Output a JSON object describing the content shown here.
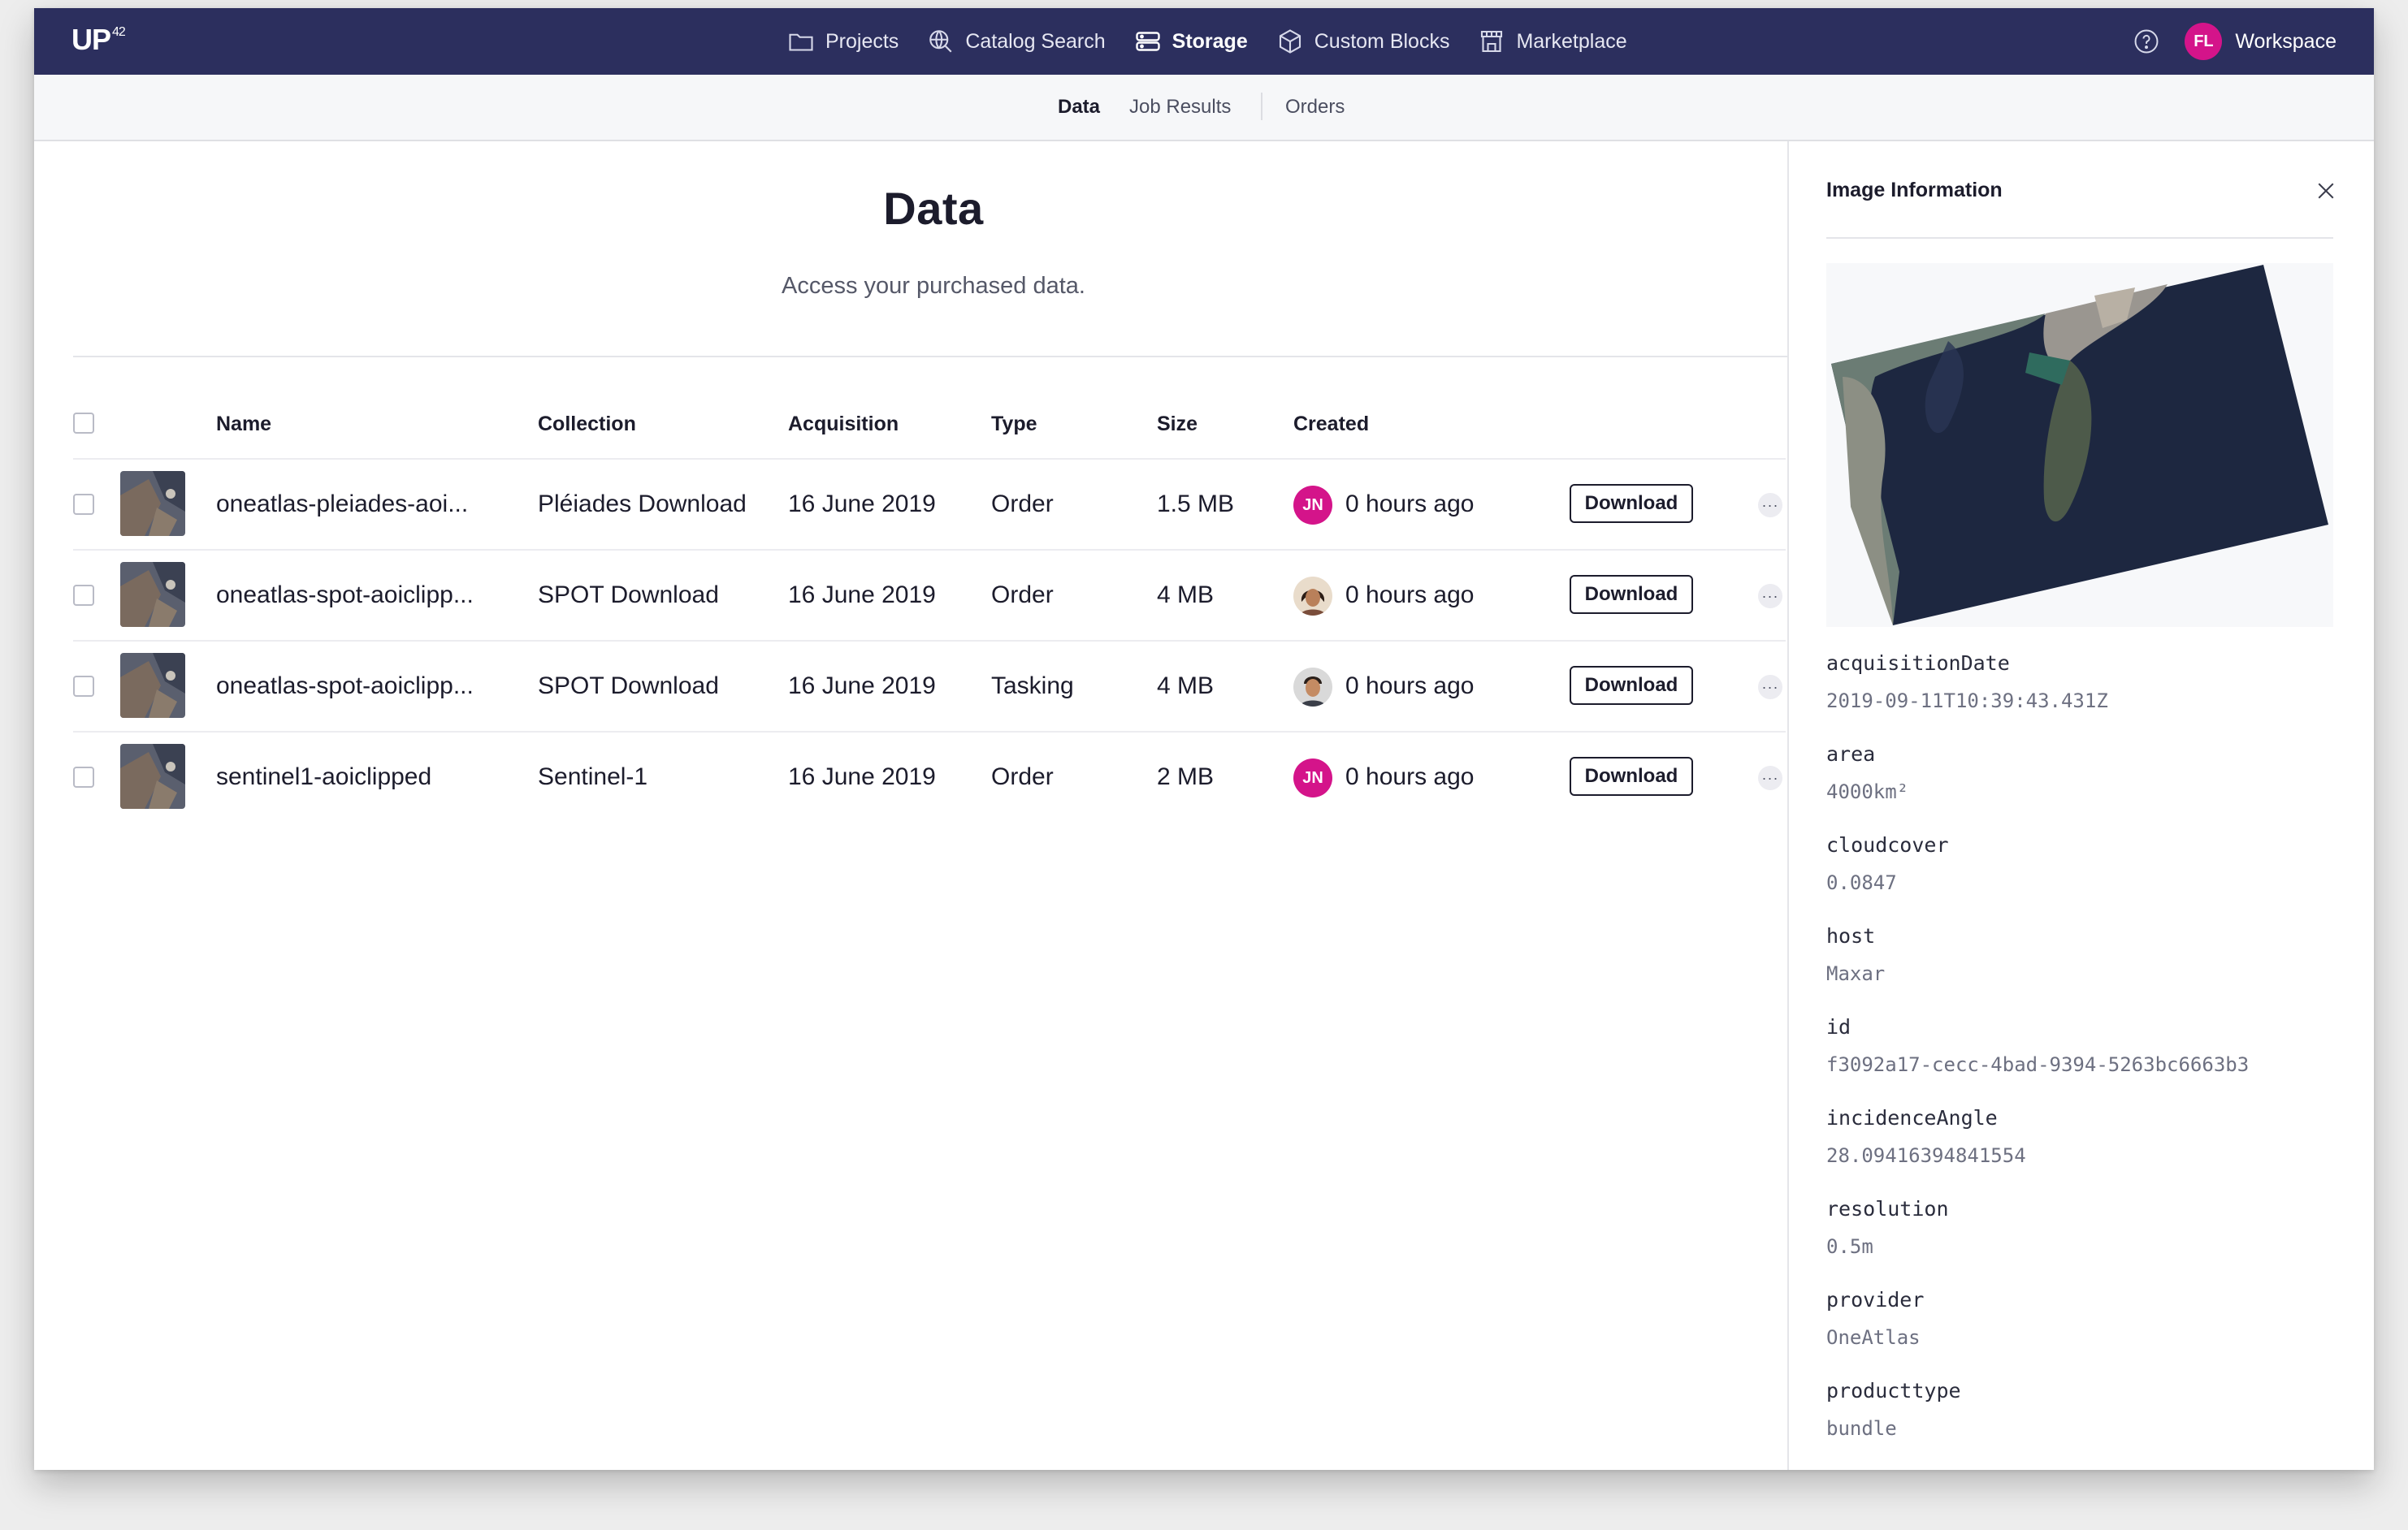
{
  "nav": {
    "logo": "UP",
    "logo_sup": "42",
    "items": [
      {
        "label": "Projects",
        "icon": "folder-icon"
      },
      {
        "label": "Catalog Search",
        "icon": "globe-search-icon"
      },
      {
        "label": "Storage",
        "icon": "storage-icon",
        "active": true
      },
      {
        "label": "Custom Blocks",
        "icon": "cube-icon"
      },
      {
        "label": "Marketplace",
        "icon": "store-icon"
      }
    ],
    "avatar_initials": "FL",
    "workspace": "Workspace"
  },
  "subnav": {
    "tabs": [
      "Data",
      "Job Results",
      "Orders"
    ],
    "active": "Data"
  },
  "main": {
    "title": "Data",
    "subtitle": "Access your purchased data.",
    "columns": {
      "name": "Name",
      "collection": "Collection",
      "acquisition": "Acquisition",
      "type": "Type",
      "size": "Size",
      "created": "Created"
    },
    "rows": [
      {
        "name": "oneatlas-pleiades-aoi...",
        "collection": "Pléiades Download",
        "acquisition": "16 June 2019",
        "type": "Order",
        "size": "1.5 MB",
        "avatar": "JN",
        "created": "0 hours ago",
        "action": "Download"
      },
      {
        "name": "oneatlas-spot-aoiclipp...",
        "collection": "SPOT Download",
        "acquisition": "16 June 2019",
        "type": "Order",
        "size": "4 MB",
        "avatar": "photo-woman",
        "created": "0 hours ago",
        "action": "Download"
      },
      {
        "name": "oneatlas-spot-aoiclipp...",
        "collection": "SPOT Download",
        "acquisition": "16 June 2019",
        "type": "Tasking",
        "size": "4 MB",
        "avatar": "photo-man",
        "created": "0 hours ago",
        "action": "Download"
      },
      {
        "name": "sentinel1-aoiclipped",
        "collection": "Sentinel-1",
        "acquisition": "16 June 2019",
        "type": "Order",
        "size": "2 MB",
        "avatar": "JN",
        "created": "0 hours ago",
        "action": "Download"
      }
    ]
  },
  "panel": {
    "title": "Image Information",
    "properties": [
      {
        "key": "acquisitionDate",
        "value": "2019-09-11T10:39:43.431Z"
      },
      {
        "key": "area",
        "value": "4000km²"
      },
      {
        "key": "cloudcover",
        "value": "0.0847"
      },
      {
        "key": "host",
        "value": "Maxar"
      },
      {
        "key": "id",
        "value": "f3092a17-cecc-4bad-9394-5263bc6663b3"
      },
      {
        "key": "incidenceAngle",
        "value": "28.09416394841554"
      },
      {
        "key": "resolution",
        "value": "0.5m"
      },
      {
        "key": "provider",
        "value": "OneAtlas"
      },
      {
        "key": "producttype",
        "value": "bundle"
      }
    ]
  },
  "colors": {
    "navbar": "#2c2f5e",
    "accent_avatar": "#d4148a"
  }
}
